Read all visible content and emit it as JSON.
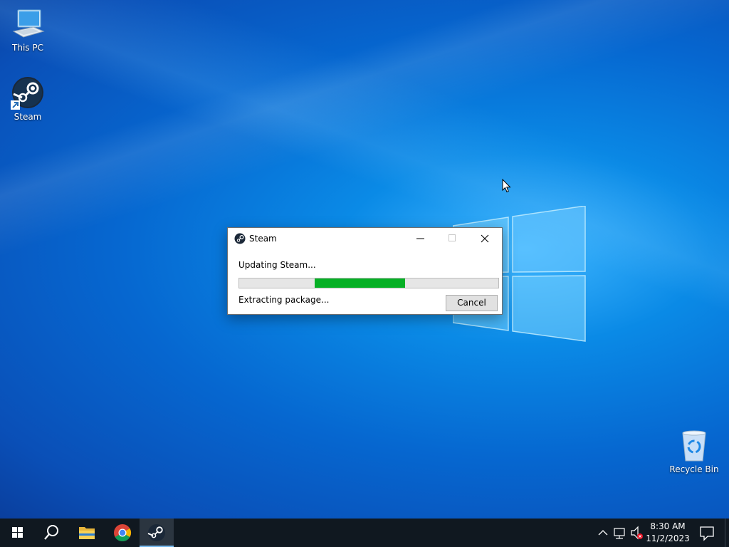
{
  "desktop": {
    "icons": [
      {
        "label": "This PC",
        "icon": "this-pc-icon"
      },
      {
        "label": "Steam",
        "icon": "steam-icon"
      },
      {
        "label": "Recycle Bin",
        "icon": "recycle-bin-icon"
      }
    ]
  },
  "dialog": {
    "title": "Steam",
    "status_primary": "Updating Steam...",
    "status_secondary": "Extracting package...",
    "cancel_label": "Cancel",
    "progress_start": 0.29,
    "progress_end": 0.64,
    "progress_color": "#06b025"
  },
  "taskbar": {
    "apps": [
      "start-icon",
      "search-icon",
      "file-explorer-icon",
      "chrome-icon",
      "steam-icon"
    ],
    "active_app": "steam-icon",
    "clock": {
      "time": "8:30 AM",
      "date": "11/2/2023"
    }
  },
  "colors": {
    "desktop_accent": "#0a78d7",
    "taskbar": "#101820",
    "accent": "#76b9ed"
  }
}
